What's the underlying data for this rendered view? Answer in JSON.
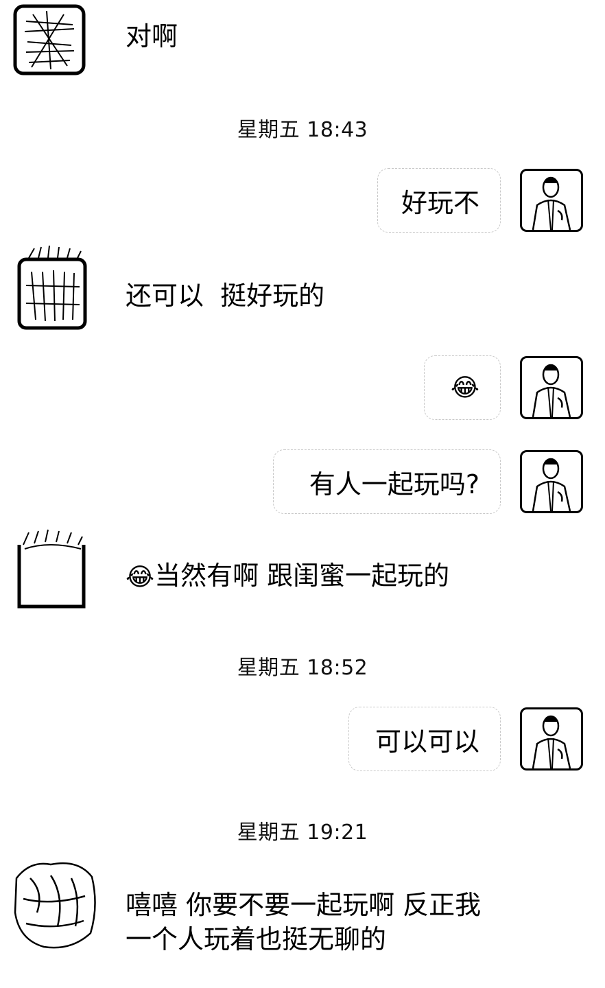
{
  "chat": {
    "messages": [
      {
        "side": "left",
        "text": "对啊"
      },
      {
        "type": "time",
        "text": "星期五 18:43"
      },
      {
        "side": "right",
        "text": "好玩不"
      },
      {
        "side": "left",
        "text": "还可以  挺好玩的"
      },
      {
        "side": "right",
        "emoji": "laughing-tears-icon",
        "glyph": "😂"
      },
      {
        "side": "right",
        "text": "有人一起玩吗?"
      },
      {
        "side": "left",
        "emoji": "laughing-tears-icon",
        "glyph": "😂",
        "text": "当然有啊 跟闺蜜一起玩的"
      },
      {
        "type": "time",
        "text": "星期五 18:52"
      },
      {
        "side": "right",
        "text": "可以可以"
      },
      {
        "type": "time",
        "text": "星期五 19:21"
      },
      {
        "side": "left",
        "lines": [
          "嘻嘻 你要不要一起玩啊 反正我",
          "一个人玩着也挺无聊的"
        ]
      }
    ]
  }
}
